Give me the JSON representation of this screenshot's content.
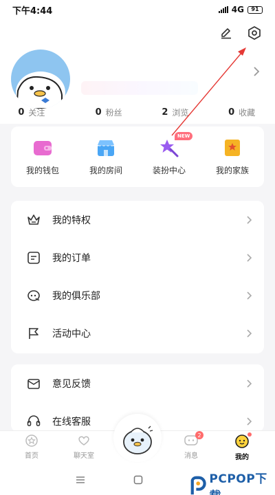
{
  "status_bar": {
    "time": "下午4:44",
    "network": "4G",
    "battery": "91"
  },
  "stats": [
    {
      "value": "0",
      "label": "关注"
    },
    {
      "value": "0",
      "label": "粉丝"
    },
    {
      "value": "2",
      "label": "浏览"
    },
    {
      "value": "0",
      "label": "收藏"
    }
  ],
  "features": [
    {
      "label": "我的钱包",
      "icon": "wallet-icon",
      "color": "#e86bd0"
    },
    {
      "label": "我的房间",
      "icon": "store-icon",
      "color": "#4aa6f5"
    },
    {
      "label": "装扮中心",
      "icon": "magic-wand-icon",
      "color": "#9a5cf0",
      "badge": "NEW"
    },
    {
      "label": "我的家族",
      "icon": "family-flag-icon",
      "color": "#f5b324"
    }
  ],
  "menu_group_1": [
    {
      "label": "我的特权",
      "icon": "crown-icon"
    },
    {
      "label": "我的订单",
      "icon": "order-icon"
    },
    {
      "label": "我的俱乐部",
      "icon": "club-icon"
    },
    {
      "label": "活动中心",
      "icon": "flag-icon"
    }
  ],
  "menu_group_2": [
    {
      "label": "意见反馈",
      "icon": "feedback-icon"
    },
    {
      "label": "在线客服",
      "icon": "headset-icon"
    }
  ],
  "tabbar": {
    "tabs": [
      {
        "label": "首页",
        "active": false
      },
      {
        "label": "聊天室",
        "active": false
      },
      {
        "label": "消息",
        "active": false,
        "badge": "2"
      },
      {
        "label": "我的",
        "active": true
      }
    ]
  },
  "watermark": {
    "text": "PCPOP下载"
  },
  "colors": {
    "annotation_arrow": "#e53935",
    "accent": "#ffd33d"
  }
}
